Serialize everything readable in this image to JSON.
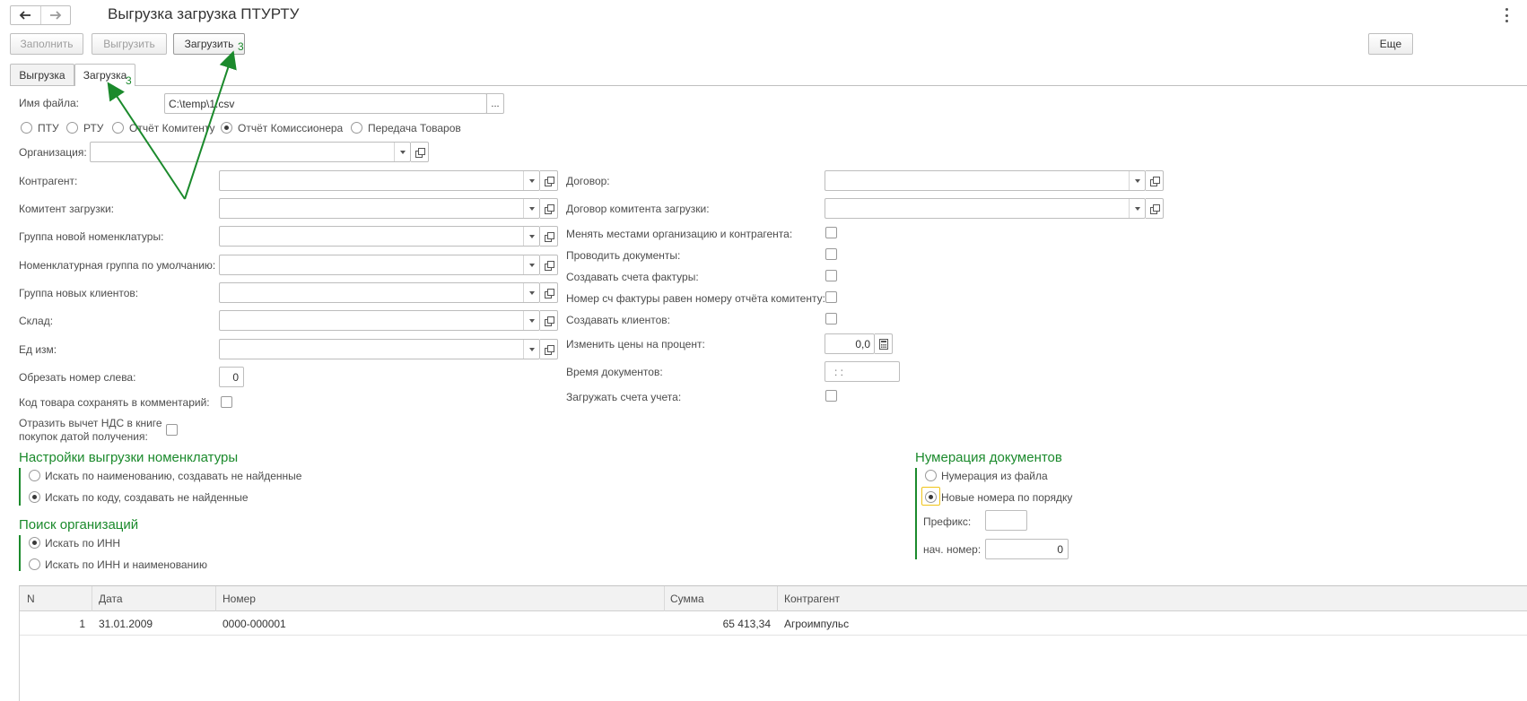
{
  "window": {
    "title": "Выгрузка загрузка ПТУРТУ",
    "more_menu_icon": "more-vertical-icon"
  },
  "nav": {
    "back_icon": "arrow-left-icon",
    "forward_icon": "arrow-right-icon"
  },
  "toolbar": {
    "fill_label": "Заполнить",
    "export_label": "Выгрузить",
    "import_label": "Загрузить",
    "more_label": "Еще"
  },
  "tabs": [
    {
      "label": "Выгрузка"
    },
    {
      "label": "Загрузка"
    }
  ],
  "file": {
    "label": "Имя файла:",
    "value": "C:\\temp\\1.csv",
    "browse": "..."
  },
  "doc_types": [
    {
      "label": "ПТУ",
      "selected": false
    },
    {
      "label": "РТУ",
      "selected": false
    },
    {
      "label": "Отчёт Комитенту",
      "selected": false
    },
    {
      "label": "Отчёт Комиссионера",
      "selected": true
    },
    {
      "label": "Передача Товаров",
      "selected": false
    }
  ],
  "left_fields": {
    "organization": "Организация:",
    "counterparty": "Контрагент:",
    "committent": "Комитент загрузки:",
    "new_item_group": "Группа новой номенклатуры:",
    "default_item_group": "Номенклатурная группа по умолчанию:",
    "new_clients_group": "Группа новых клиентов:",
    "warehouse": "Склад:",
    "unit": "Ед изм:",
    "trim_number": "Обрезать номер слева:",
    "trim_number_value": "0",
    "save_code": "Код товара сохранять в комментарий:",
    "vat_line1": "Отразить вычет НДС в книге",
    "vat_line2": "покупок датой получения:"
  },
  "right_fields": {
    "contract": "Договор:",
    "committent_contract": "Договор комитента загрузки:",
    "swap": "Менять местами организацию и контрагента:",
    "post_docs": "Проводить документы:",
    "create_invoices": "Создавать счета фактуры:",
    "invoice_number": "Номер сч фактуры равен номеру отчёта комитенту:",
    "create_clients": "Создавать клиентов:",
    "price_change": "Изменить цены на процент:",
    "price_change_value": "0,0",
    "doc_time": "Время документов:",
    "doc_time_value": ":  :",
    "load_accounts": "Загружать счета учета:"
  },
  "nomenclature_settings": {
    "title": "Настройки выгрузки номенклатуры",
    "options": [
      {
        "label": "Искать по наименованию, создавать не найденные",
        "selected": false
      },
      {
        "label": "Искать по коду, создавать не найденные",
        "selected": true
      }
    ]
  },
  "org_search": {
    "title": "Поиск организаций",
    "options": [
      {
        "label": "Искать по ИНН",
        "selected": true
      },
      {
        "label": "Искать по ИНН и наименованию",
        "selected": false
      }
    ]
  },
  "numbering": {
    "title": "Нумерация документов",
    "options": [
      {
        "label": "Нумерация из файла",
        "selected": false
      },
      {
        "label": "Новые номера по порядку",
        "selected": true
      }
    ],
    "prefix_label": "Префикс:",
    "prefix_value": "",
    "start_label": "нач. номер:",
    "start_value": "0"
  },
  "table": {
    "columns": [
      "N",
      "Дата",
      "Номер",
      "Сумма",
      "Контрагент"
    ],
    "rows": [
      {
        "n": "1",
        "date": "31.01.2009",
        "number": "0000-000001",
        "sum": "65 413,34",
        "counterparty": "Агроимпульс"
      }
    ]
  },
  "annotations": {
    "step_a": "3",
    "step_b": "3",
    "arrow_color": "#1b8a2c"
  }
}
